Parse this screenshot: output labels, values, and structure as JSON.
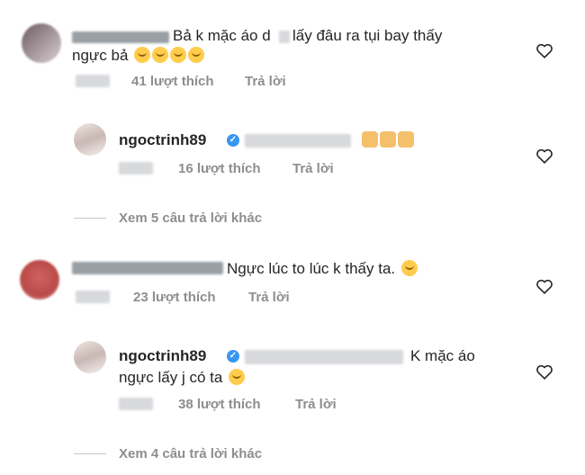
{
  "comments": [
    {
      "id": "c1",
      "text_line1": "Bả k mặc áo d",
      "text_line1b": "lấy đâu ra tụi bay thấy",
      "text_line2": "ngực bả",
      "likes": "41 lượt thích",
      "reply": "Trả lời"
    },
    {
      "id": "r1",
      "username": "ngoctrinh89",
      "likes": "16 lượt thích",
      "reply": "Trả lời"
    },
    {
      "id": "more1",
      "more": "Xem 5 câu trả lời khác"
    },
    {
      "id": "c2",
      "text": "Ngực lúc to lúc k thấy ta.",
      "likes": "23 lượt thích",
      "reply": "Trả lời"
    },
    {
      "id": "r2",
      "username": "ngoctrinh89",
      "text_line1": "K mặc áo",
      "text_line2": "ngực lấy j có ta",
      "likes": "38 lượt thích",
      "reply": "Trả lời"
    },
    {
      "id": "more2",
      "more": "Xem 4 câu trả lời khác"
    }
  ],
  "icons": {
    "heart": "heart-outline-icon",
    "verified": "verified-badge-icon",
    "emoji_laugh": "laughing-tears-emoji",
    "emoji_clap": "clapping-hands-emoji",
    "emoji_cry": "crying-face-emoji",
    "emoji_rofl": "rolling-laughing-emoji"
  },
  "colors": {
    "text": "#262626",
    "meta": "#8e8e8e",
    "verified": "#3897f0"
  }
}
